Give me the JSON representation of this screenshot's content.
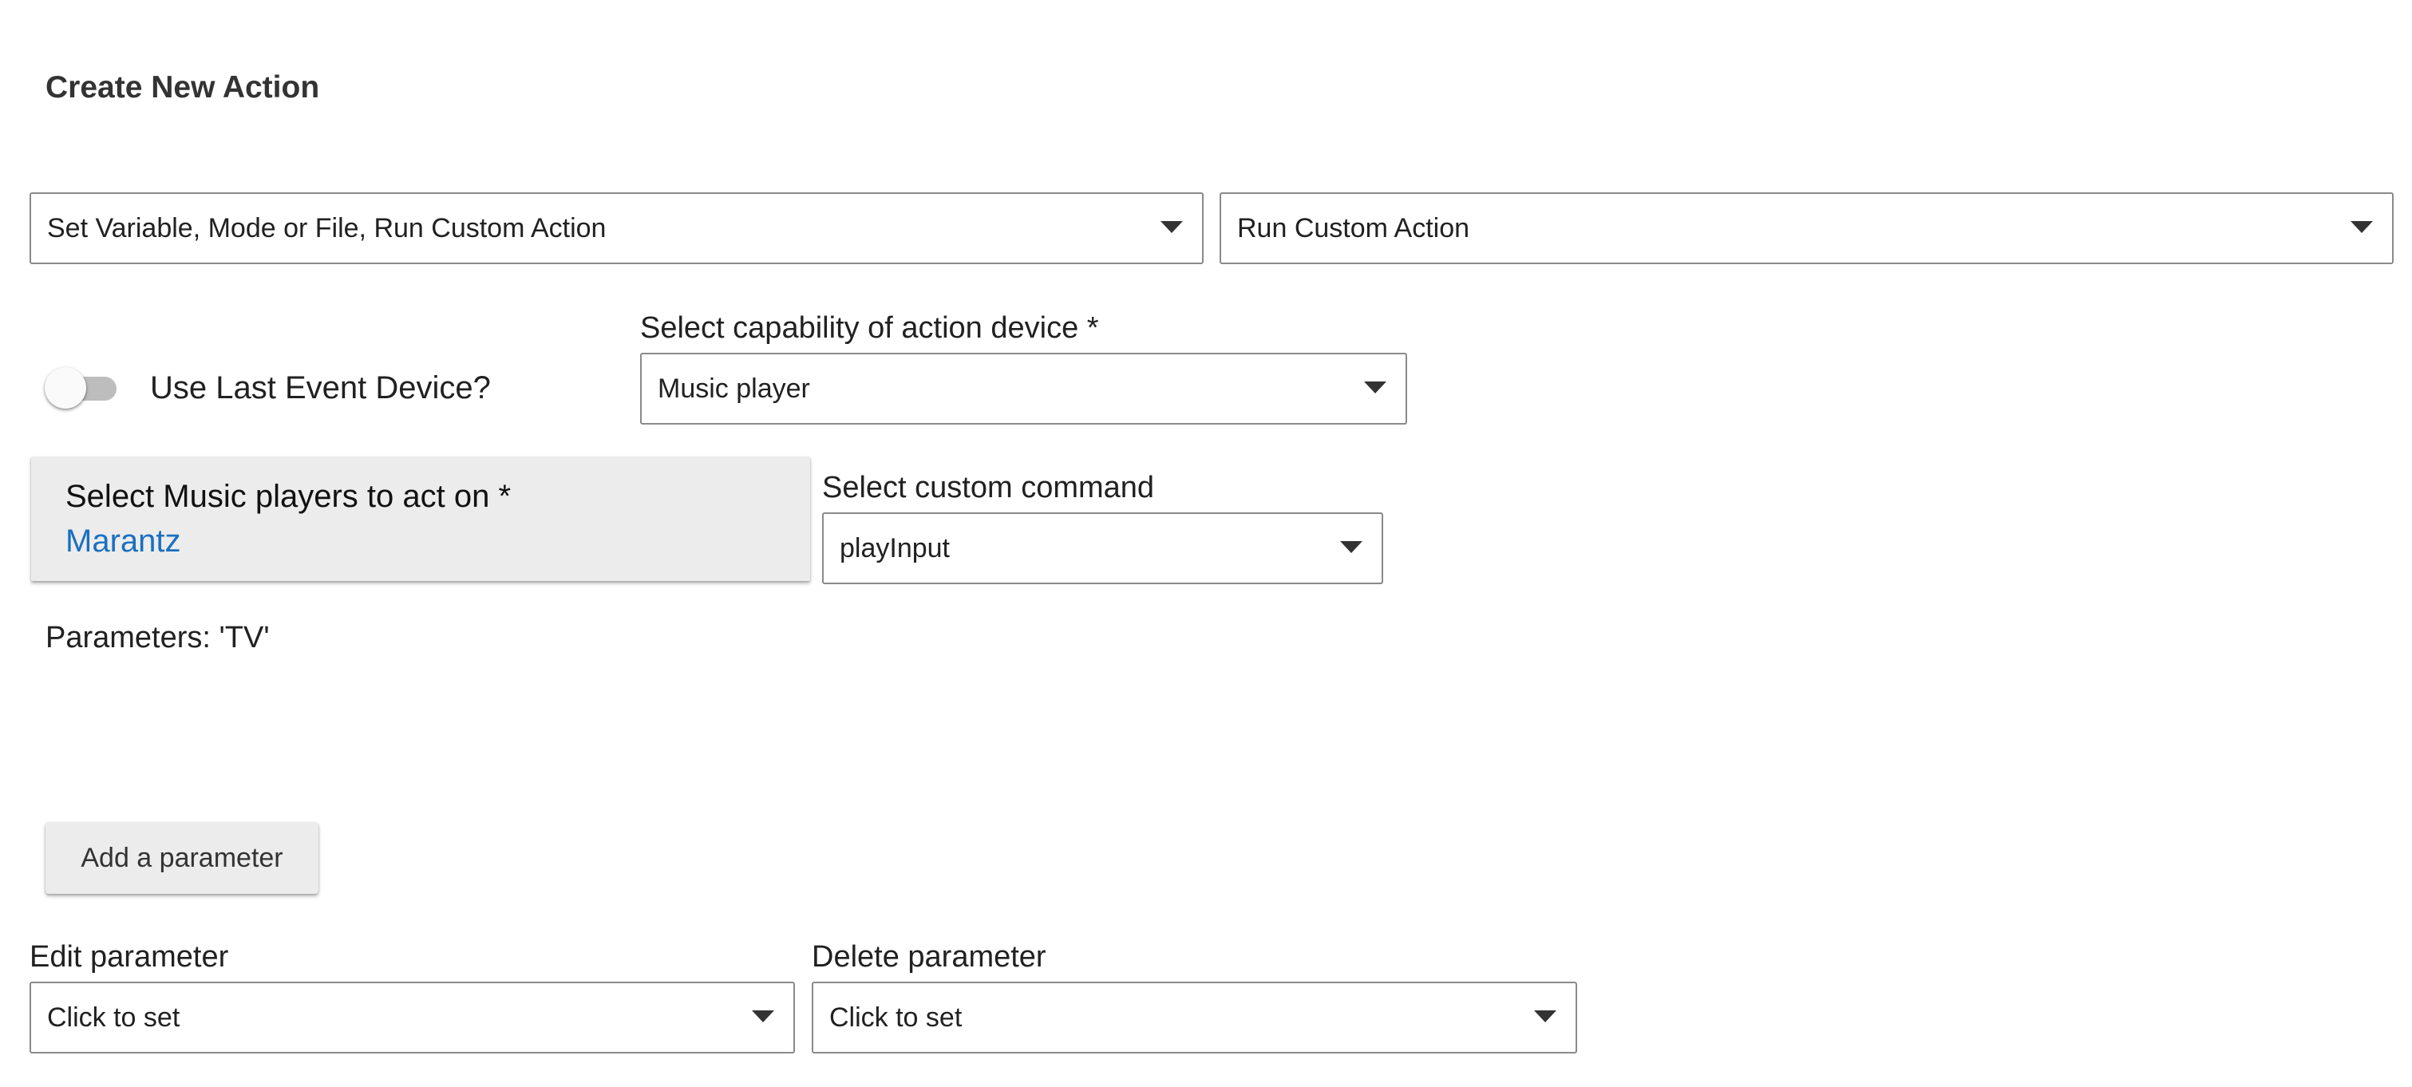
{
  "header": {
    "title": "Create New Action"
  },
  "action_selects": {
    "category": {
      "value": "Set Variable, Mode or File, Run Custom Action"
    },
    "action": {
      "value": "Run Custom Action"
    }
  },
  "last_event_device": {
    "label": "Use Last Event Device?",
    "enabled": false
  },
  "capability": {
    "label": "Select capability of action device *",
    "value": "Music player"
  },
  "devices": {
    "label": "Select Music players to act on *",
    "selected": "Marantz"
  },
  "custom_command": {
    "label": "Select custom command",
    "value": "playInput"
  },
  "parameters": {
    "summary": "Parameters: 'TV'",
    "add_button_label": "Add a parameter",
    "edit": {
      "label": "Edit parameter",
      "value": "Click to set"
    },
    "delete": {
      "label": "Delete parameter",
      "value": "Click to set"
    }
  },
  "icons": {
    "dropdown": "caret-down-icon"
  },
  "colors": {
    "link": "#1a6fc0",
    "card_background": "#ececec",
    "border": "#8a8a8a"
  }
}
